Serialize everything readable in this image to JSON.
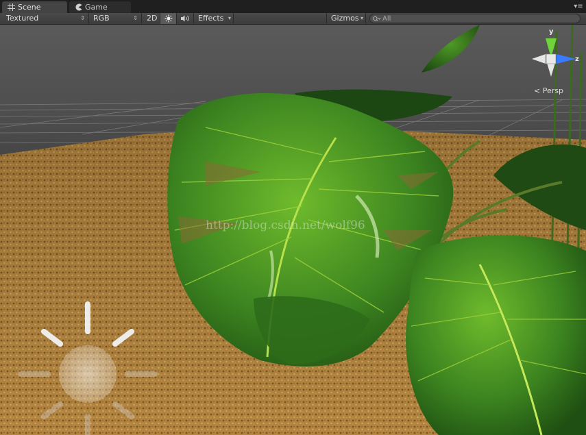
{
  "tabs": [
    {
      "label": "Scene",
      "icon": "scene-grid-icon",
      "active": true
    },
    {
      "label": "Game",
      "icon": "game-pacman-icon",
      "active": false
    }
  ],
  "toolbar": {
    "render_mode": "Textured",
    "color_mode": "RGB",
    "mode_2d": "2D",
    "lighting_icon": "sun-icon",
    "audio_icon": "speaker-icon",
    "effects_label": "Effects",
    "gizmos_label": "Gizmos",
    "search_placeholder": "All"
  },
  "gizmo": {
    "axis_y": "y",
    "axis_z": "z",
    "projection": "Persp"
  },
  "watermark": "http://blog.csdn.net/wolf96",
  "colors": {
    "axis_y": "#6fd33b",
    "axis_z": "#3a7bff",
    "leaf": "#3f8a22",
    "ground": "#b88a4a"
  }
}
